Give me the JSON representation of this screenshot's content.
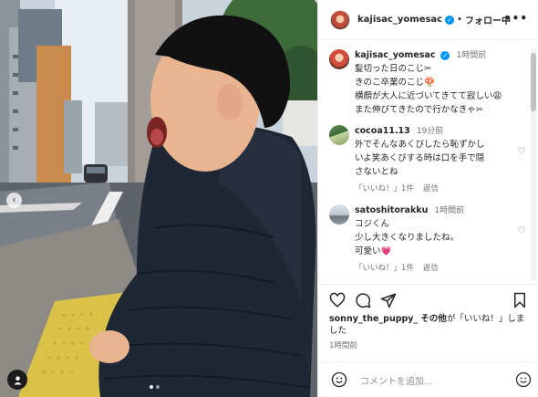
{
  "header": {
    "username": "kajisac_yomesac",
    "separator": "•",
    "follow_label": "フォロー中",
    "more_label": "•••"
  },
  "caption": {
    "username": "kajisac_yomesac",
    "time": "1時間前",
    "lines": [
      "髪切った日のこじ✂︎",
      "きのこ卒業のこじ🍄",
      "横顔が大人に近づいてきてて寂しい😩",
      "また伸びてきたので行かなきゃ✂︎"
    ]
  },
  "comments": [
    {
      "username": "cocoa11.13",
      "time": "19分前",
      "lines": [
        "外でそんなあくびしたら恥ずかし",
        "いよ笑あくびする時は口を手で隠",
        "さないとね"
      ],
      "like_label": "「いいね！」1件",
      "reply_label": "返信"
    },
    {
      "username": "satoshitorakku",
      "time": "1時間前",
      "lines": [
        "コジくん",
        "少し大きくなりましたね。",
        "可愛い💗"
      ],
      "like_label": "「いいね！」1件",
      "reply_label": "返信"
    }
  ],
  "likes": {
    "user": "sonny_the_puppy_",
    "others": "その他",
    "suffix": "が「いいね！」しま",
    "suffix2": "した"
  },
  "posted_time": "1時間前",
  "add_comment": {
    "placeholder": "コメントを追加..."
  },
  "carousel": {
    "total": 2,
    "active": 1,
    "prev_label": "‹"
  },
  "icons": [
    "heart-icon",
    "comment-icon",
    "share-icon",
    "bookmark-icon",
    "emoji-icon",
    "smile-icon",
    "user-tag-icon",
    "verified-icon"
  ],
  "colors": {
    "verified": "#0095f6",
    "text": "#262626",
    "muted": "#737373",
    "placeholder": "#8e8e8e"
  }
}
